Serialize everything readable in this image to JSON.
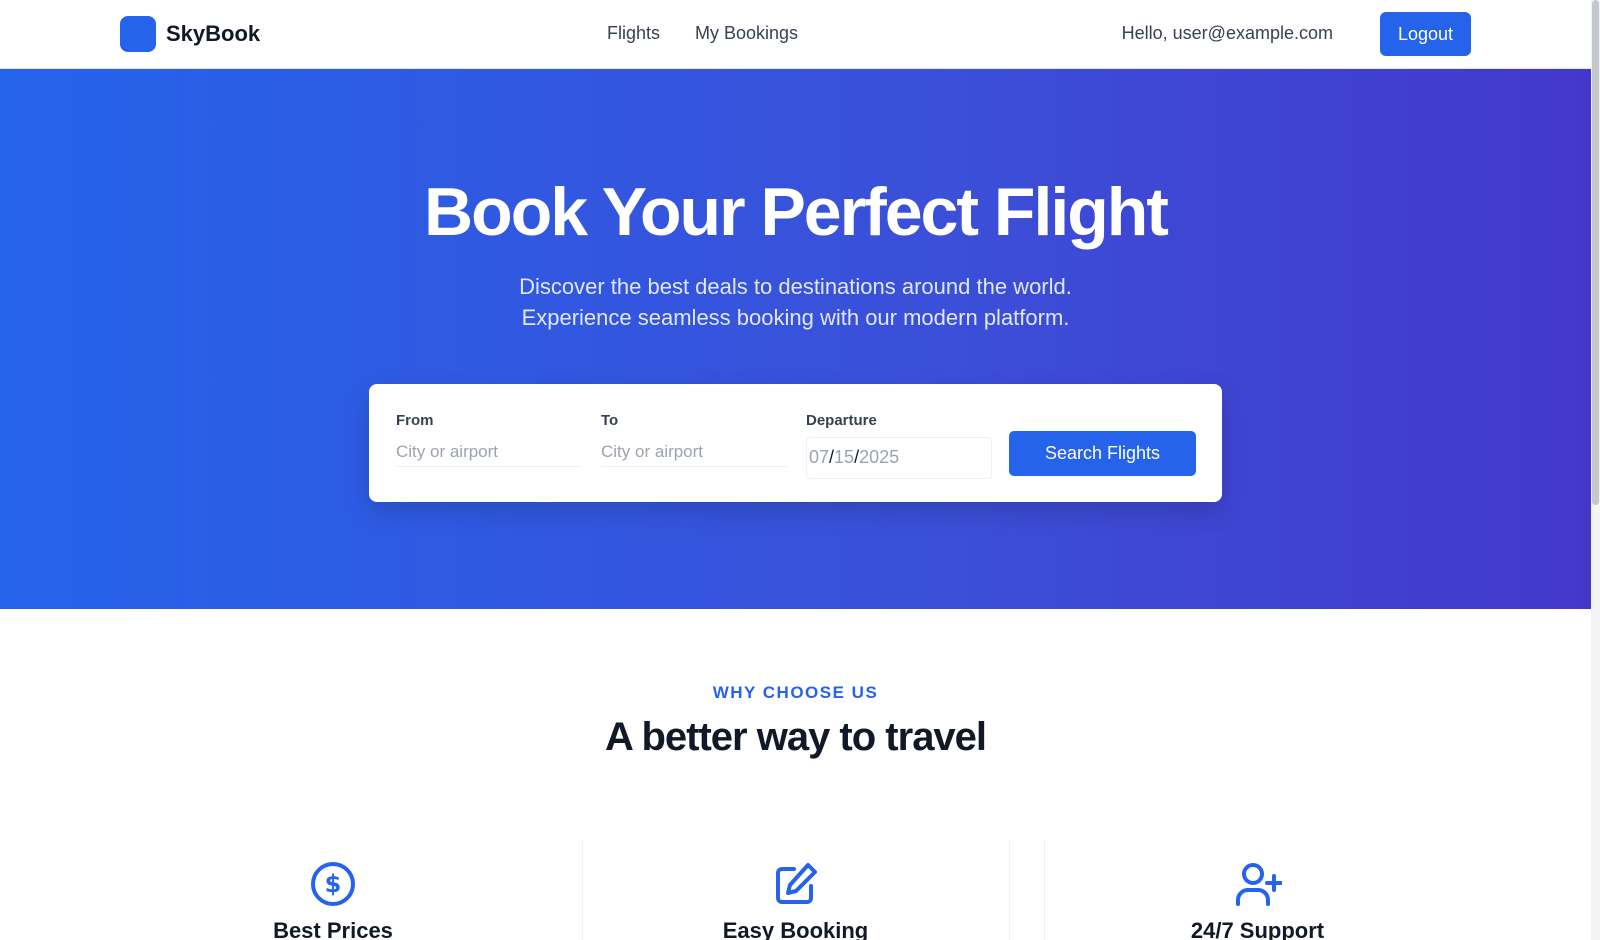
{
  "nav": {
    "brand": "SkyBook",
    "links": [
      "Flights",
      "My Bookings"
    ],
    "greeting": "Hello, user@example.com",
    "logout": "Logout"
  },
  "hero": {
    "title": "Book Your Perfect Flight",
    "subtitle_line1": "Discover the best deals to destinations around the world.",
    "subtitle_line2": "Experience seamless booking with our modern platform."
  },
  "search": {
    "from_label": "From",
    "from_placeholder": "City or airport",
    "to_label": "To",
    "to_placeholder": "City or airport",
    "departure_label": "Departure",
    "date_month": "07",
    "date_day": "15",
    "date_year": "2025",
    "button": "Search Flights"
  },
  "features": {
    "eyebrow": "WHY CHOOSE US",
    "title": "A better way to travel",
    "items": [
      {
        "icon": "dollar-icon",
        "title": "Best Prices"
      },
      {
        "icon": "edit-icon",
        "title": "Easy Booking"
      },
      {
        "icon": "user-plus-icon",
        "title": "24/7 Support"
      }
    ]
  },
  "colors": {
    "accent": "#2563eb",
    "hero_start": "#2563eb",
    "hero_end": "#4338ca"
  }
}
